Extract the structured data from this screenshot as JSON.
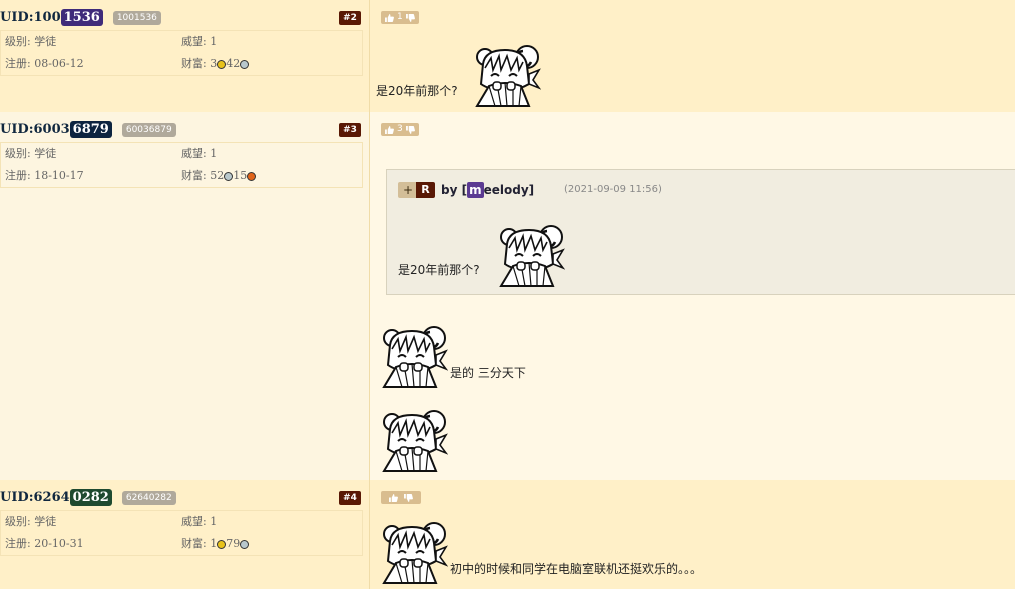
{
  "posts": [
    {
      "uid_prefix": "UID:100",
      "uid_highlight": "1536",
      "uid_tag": "1001536",
      "floor": "#2",
      "level_label": "级别: 学徒",
      "prestige_label": "威望: 1",
      "register_label": "注册: 08-06-12",
      "wealth_label": "财富: ",
      "wealth_a": "3",
      "wealth_b": "42",
      "votes": "1",
      "text": "是20年前那个?"
    },
    {
      "uid_prefix": "UID:6003",
      "uid_highlight": "6879",
      "uid_tag": "60036879",
      "floor": "#3",
      "level_label": "级别: 学徒",
      "prestige_label": "威望: 1",
      "register_label": "注册: 18-10-17",
      "wealth_label": "财富: ",
      "wealth_a": "52",
      "wealth_b": "15",
      "votes": "3",
      "quote": {
        "plus": "+",
        "r": "R",
        "by": "by [",
        "author_first": "m",
        "author_rest": "eelody]",
        "date": "(2021-09-09 11:56)",
        "text": "是20年前那个?"
      },
      "text": "是的 三分天下"
    },
    {
      "uid_prefix": "UID:6264",
      "uid_highlight": "0282",
      "uid_tag": "62640282",
      "floor": "#4",
      "level_label": "级别: 学徒",
      "prestige_label": "威望: 1",
      "register_label": "注册: 20-10-31",
      "wealth_label": "财富: ",
      "wealth_a": "1",
      "wealth_b": "79",
      "votes": "",
      "text": "初中的时候和同学在电脑室联机还挺欢乐的。。。"
    }
  ],
  "colors": {
    "uid_highlight_1": "#3f2b7a",
    "uid_highlight_2": "#0d2440",
    "uid_highlight_3": "#1f4a2f",
    "floor_tag": "#591804"
  },
  "icons": [
    "thumbs-up-icon",
    "thumbs-down-icon",
    "gold-coin-icon",
    "silver-coin-icon",
    "copper-coin-icon",
    "sticker-emoticon"
  ]
}
